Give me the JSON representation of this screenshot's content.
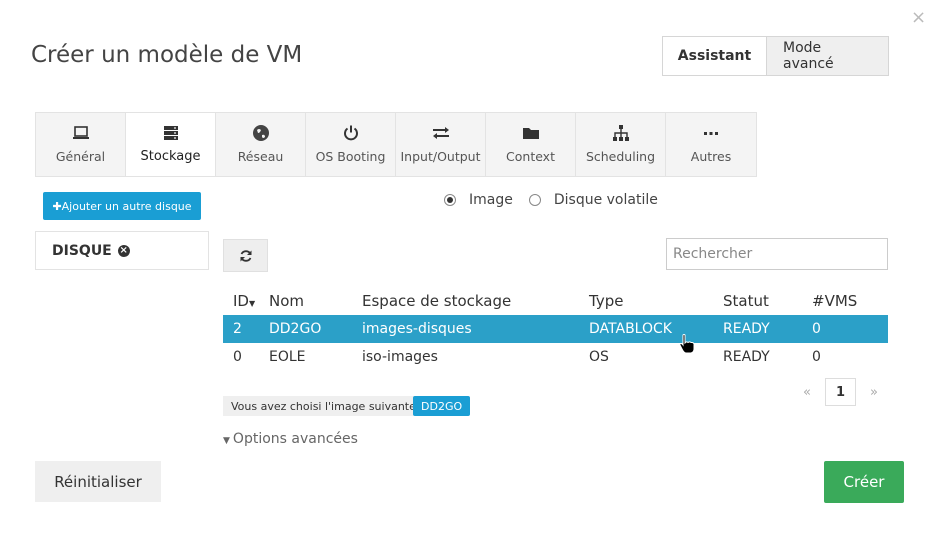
{
  "dialog": {
    "title": "Créer un modèle de VM",
    "close_glyph": "×",
    "modes": {
      "wizard": "Assistant",
      "advanced": "Mode avancé"
    }
  },
  "tabs": [
    {
      "label": "Général",
      "icon": "laptop-icon",
      "active": false
    },
    {
      "label": "Stockage",
      "icon": "storage-icon",
      "active": true
    },
    {
      "label": "Réseau",
      "icon": "globe-icon",
      "active": false
    },
    {
      "label": "OS Booting",
      "icon": "power-icon",
      "active": false
    },
    {
      "label": "Input/Output",
      "icon": "exchange-icon",
      "active": false
    },
    {
      "label": "Context",
      "icon": "folder-icon",
      "active": false
    },
    {
      "label": "Scheduling",
      "icon": "sitemap-icon",
      "active": false
    },
    {
      "label": "Autres",
      "icon": "ellipsis-icon",
      "active": false
    }
  ],
  "storage": {
    "add_disk_label": "✚Ajouter un autre disque",
    "disk_label": "DISQUE",
    "remove_glyph": "×",
    "radio": {
      "image": "Image",
      "volatile": "Disque volatile",
      "selected": "image"
    },
    "search_placeholder": "Rechercher",
    "columns": {
      "id": "ID",
      "name": "Nom",
      "datastore": "Espace de stockage",
      "type": "Type",
      "status": "Statut",
      "vms": "#VMS"
    },
    "rows": [
      {
        "id": "2",
        "name": "DD2GO",
        "datastore": "images-disques",
        "type": "DATABLOCK",
        "status": "READY",
        "vms": "0",
        "selected": true
      },
      {
        "id": "0",
        "name": "EOLE",
        "datastore": "iso-images",
        "type": "OS",
        "status": "READY",
        "vms": "0",
        "selected": false
      }
    ],
    "pagination": {
      "prev": "«",
      "current": "1",
      "next": "»"
    },
    "chosen_prefix": "Vous avez choisi l'image suivante:",
    "chosen_value": "DD2GO",
    "advanced_options": "Options avancées"
  },
  "footer": {
    "reset": "Réinitialiser",
    "create": "Créer"
  },
  "colors": {
    "primary": "#1a9ed4",
    "selected_row": "#2ba0c8",
    "success": "#3aaa5a"
  }
}
